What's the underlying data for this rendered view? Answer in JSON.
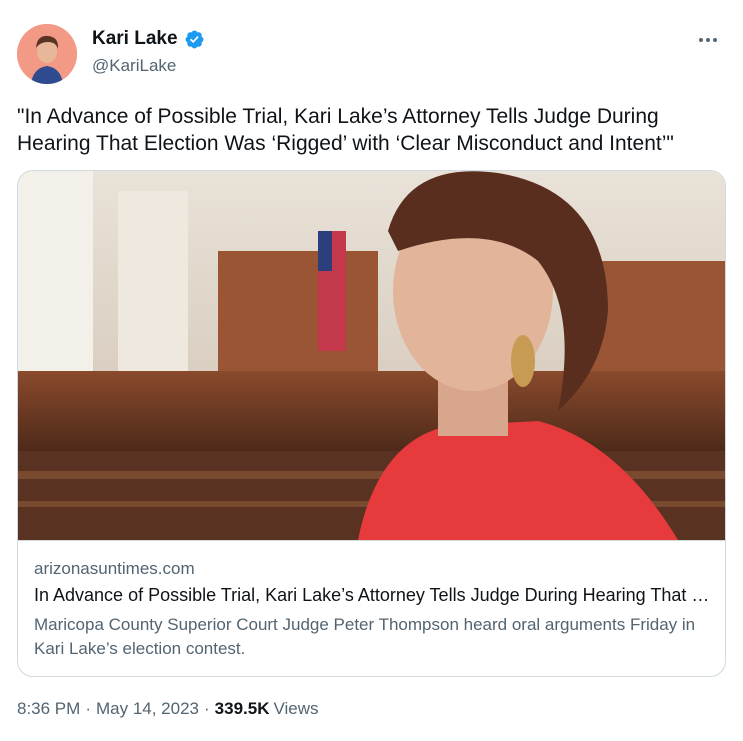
{
  "author": {
    "name": "Kari Lake",
    "handle": "@KariLake",
    "verified": true,
    "avatar_icon": "profile-photo"
  },
  "tweet": {
    "text": "\"In Advance of Possible Trial, Kari Lake’s Attorney Tells Judge During Hearing That Election Was ‘Rigged’ with ‘Clear Misconduct and Intent’\""
  },
  "card": {
    "image_icon": "courtroom-portrait-photo",
    "domain": "arizonasuntimes.com",
    "title": "In Advance of Possible Trial, Kari Lake’s Attorney Tells Judge During Hearing That Election Was ‘Rigged’ with ‘Clear Misconduct and Intent’",
    "description": "Maricopa County Superior Court Judge Peter Thompson heard oral arguments Friday in Kari Lake’s election contest."
  },
  "meta": {
    "time": "8:36 PM",
    "separator": "·",
    "date": "May 14, 2023",
    "views_count": "339.5K",
    "views_label": "Views"
  },
  "colors": {
    "verified": "#1d9bf0",
    "secondary_text": "#536471",
    "primary_text": "#0f1419",
    "border": "#cfd9de"
  }
}
